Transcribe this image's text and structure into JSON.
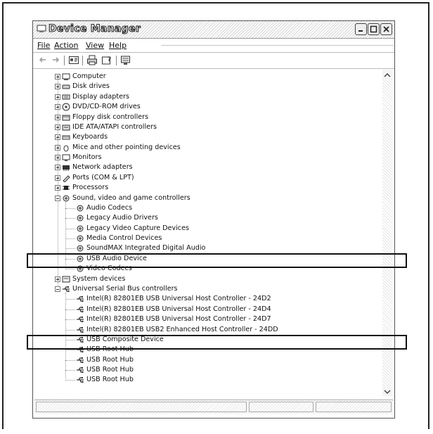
{
  "window": {
    "title": "Device Manager",
    "buttons": [
      "minimize",
      "maximize",
      "close"
    ]
  },
  "menu": [
    {
      "label": "File",
      "underline_index": 0
    },
    {
      "label": "Action",
      "underline_index": 0
    },
    {
      "label": "View",
      "underline_index": 0
    },
    {
      "label": "Help",
      "underline_index": 0
    }
  ],
  "toolbar": {
    "icons": [
      "back-arrow-icon",
      "forward-arrow-icon",
      "properties-icon",
      "print-icon",
      "help-icon",
      "scan-hardware-icon"
    ]
  },
  "tree": [
    {
      "label": "Computer",
      "icon": "computer-icon",
      "level": 0,
      "expander": "plus"
    },
    {
      "label": "Disk drives",
      "icon": "disk-drive-icon",
      "level": 0,
      "expander": "plus"
    },
    {
      "label": "Display adapters",
      "icon": "display-adapter-icon",
      "level": 0,
      "expander": "plus"
    },
    {
      "label": "DVD/CD-ROM drives",
      "icon": "cdrom-icon",
      "level": 0,
      "expander": "plus"
    },
    {
      "label": "Floppy disk controllers",
      "icon": "floppy-controller-icon",
      "level": 0,
      "expander": "plus"
    },
    {
      "label": "IDE ATA/ATAPI controllers",
      "icon": "ide-controller-icon",
      "level": 0,
      "expander": "plus"
    },
    {
      "label": "Keyboards",
      "icon": "keyboard-icon",
      "level": 0,
      "expander": "plus"
    },
    {
      "label": "Mice and other pointing devices",
      "icon": "mouse-icon",
      "level": 0,
      "expander": "plus"
    },
    {
      "label": "Monitors",
      "icon": "monitor-icon",
      "level": 0,
      "expander": "plus"
    },
    {
      "label": "Network adapters",
      "icon": "network-adapter-icon",
      "level": 0,
      "expander": "plus"
    },
    {
      "label": "Ports (COM & LPT)",
      "icon": "port-icon",
      "level": 0,
      "expander": "plus"
    },
    {
      "label": "Processors",
      "icon": "processor-icon",
      "level": 0,
      "expander": "plus"
    },
    {
      "label": "Sound, video and game controllers",
      "icon": "sound-icon",
      "level": 0,
      "expander": "minus"
    },
    {
      "label": "Audio Codecs",
      "icon": "sound-icon",
      "level": 1,
      "expander": "none"
    },
    {
      "label": "Legacy Audio Drivers",
      "icon": "sound-icon",
      "level": 1,
      "expander": "none"
    },
    {
      "label": "Legacy Video Capture Devices",
      "icon": "sound-icon",
      "level": 1,
      "expander": "none"
    },
    {
      "label": "Media Control Devices",
      "icon": "sound-icon",
      "level": 1,
      "expander": "none"
    },
    {
      "label": "SoundMAX Integrated Digital Audio",
      "icon": "sound-icon",
      "level": 1,
      "expander": "none"
    },
    {
      "label": "USB Audio Device",
      "icon": "sound-icon",
      "level": 1,
      "expander": "none",
      "highlighted": true
    },
    {
      "label": "Video Codecs",
      "icon": "sound-icon",
      "level": 1,
      "expander": "none"
    },
    {
      "label": "System devices",
      "icon": "system-device-icon",
      "level": 0,
      "expander": "plus"
    },
    {
      "label": "Universal Serial Bus controllers",
      "icon": "usb-icon",
      "level": 0,
      "expander": "minus"
    },
    {
      "label": "Intel(R) 82801EB USB Universal Host Controller - 24D2",
      "icon": "usb-icon",
      "level": 1,
      "expander": "none"
    },
    {
      "label": "Intel(R) 82801EB USB Universal Host Controller - 24D4",
      "icon": "usb-icon",
      "level": 1,
      "expander": "none"
    },
    {
      "label": "Intel(R) 82801EB USB Universal Host Controller - 24D7",
      "icon": "usb-icon",
      "level": 1,
      "expander": "none"
    },
    {
      "label": "Intel(R) 82801EB USB2 Enhanced Host Controller - 24DD",
      "icon": "usb-icon",
      "level": 1,
      "expander": "none"
    },
    {
      "label": "USB Composite Device",
      "icon": "usb-icon",
      "level": 1,
      "expander": "none",
      "highlighted": true
    },
    {
      "label": "USB Root Hub",
      "icon": "usb-icon",
      "level": 1,
      "expander": "none"
    },
    {
      "label": "USB Root Hub",
      "icon": "usb-icon",
      "level": 1,
      "expander": "none"
    },
    {
      "label": "USB Root Hub",
      "icon": "usb-icon",
      "level": 1,
      "expander": "none"
    },
    {
      "label": "USB Root Hub",
      "icon": "usb-icon",
      "level": 1,
      "expander": "none"
    }
  ]
}
